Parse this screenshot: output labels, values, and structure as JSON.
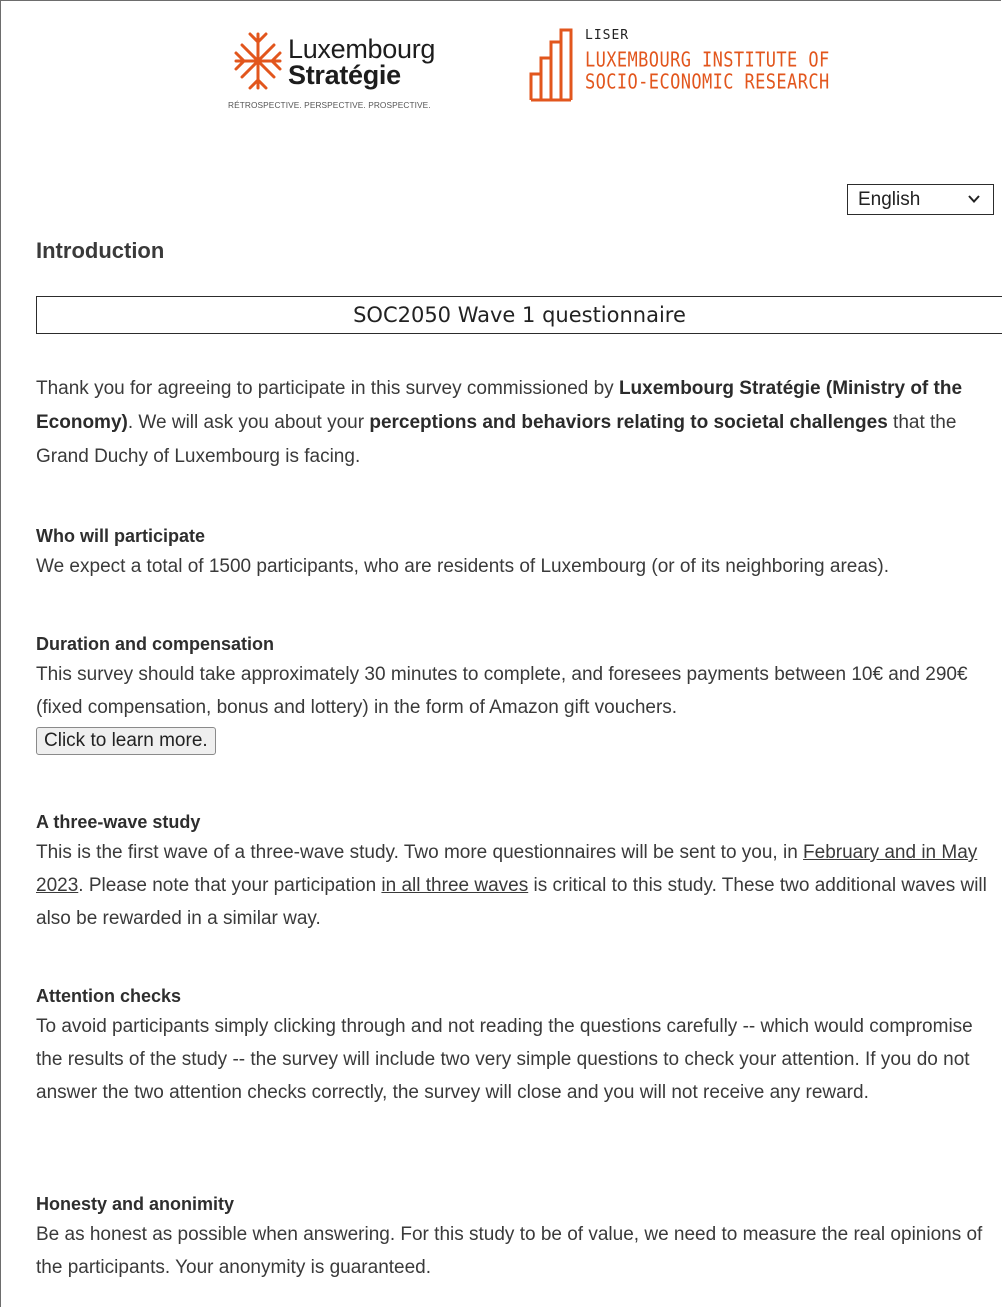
{
  "logos": {
    "luxembourg_strategie": {
      "line1": "Luxembourg",
      "line2": "Stratégie",
      "tagline": "RÉTROSPECTIVE. PERSPECTIVE. PROSPECTIVE."
    },
    "liser": {
      "abbr": "LISER",
      "line1": "LUXEMBOURG INSTITUTE OF",
      "line2": "SOCIO-ECONOMIC RESEARCH",
      "color": "#e2561d"
    }
  },
  "language_select": {
    "selected": "English",
    "icon": "chevron-down-icon"
  },
  "page_title": "Introduction",
  "questionnaire_title": "SOC2050 Wave 1 questionnaire",
  "intro": {
    "t1": "Thank you for agreeing to participate in this survey commissioned by ",
    "b1": "Luxembourg Stratégie (Ministry of the Economy)",
    "t2": ". We will ask you about your ",
    "b2": "perceptions and behaviors relating to societal challenges",
    "t3": " that the Grand Duchy of Luxembourg is facing."
  },
  "sections": {
    "who": {
      "heading": "Who will participate",
      "text": "We expect a total of 1500 participants, who are residents of Luxembourg (or of its neighboring areas)."
    },
    "duration": {
      "heading": "Duration and compensation",
      "text": "This survey should take approximately 30 minutes to complete, and foresees payments between 10€ and 290€ (fixed compensation, bonus and lottery) in the form of Amazon gift vouchers.",
      "button": "Click to learn more."
    },
    "three_wave": {
      "heading": "A three-wave study",
      "t1": "This is the first wave of a three-wave study. Two more questionnaires will be sent to you, in ",
      "u1": "February and in May 2023",
      "t2": ". Please note that your participation ",
      "u2": "in all three waves",
      "t3": " is critical to this study. These two additional waves will also be rewarded in a similar way."
    },
    "attention": {
      "heading": "Attention checks",
      "text": "To avoid participants simply clicking through and not reading the questions carefully -- which would compromise the results of the study -- the survey will include two very simple questions to check your attention. If you do not answer the two attention checks correctly, the survey will close and you will not receive any reward."
    },
    "honesty": {
      "heading": "Honesty and anonimity",
      "text": "Be as honest as possible when answering. For this study to be of value, we need to measure the real opinions of the participants. Your anonymity is guaranteed."
    }
  }
}
